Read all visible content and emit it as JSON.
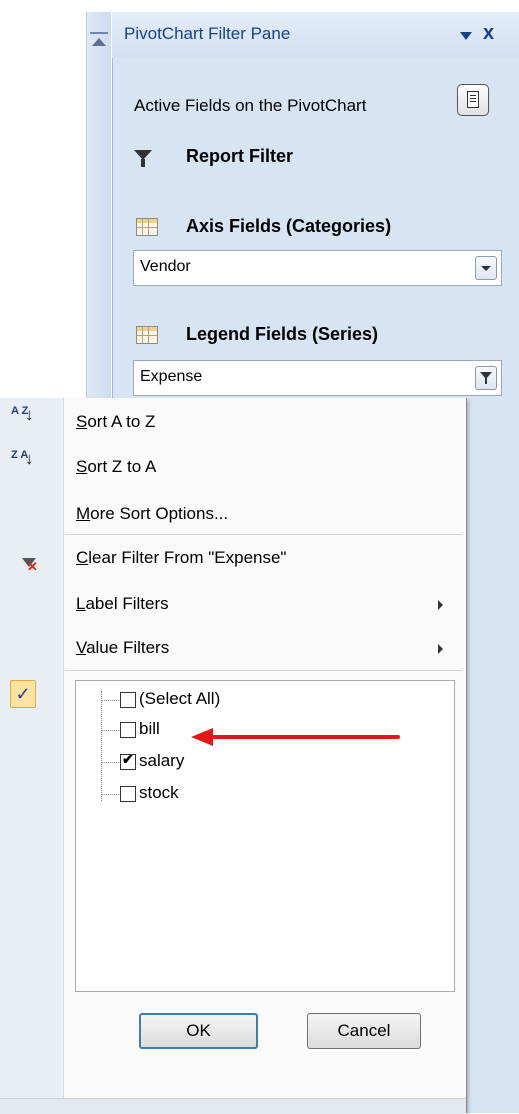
{
  "pane": {
    "title": "PivotChart Filter Pane",
    "close_glyph": "x",
    "active_fields_label": "Active Fields on the PivotChart",
    "report_filter_label": "Report Filter",
    "axis_fields_label": "Axis Fields (Categories)",
    "axis_field_value": "Vendor",
    "legend_fields_label": "Legend Fields (Series)",
    "legend_field_value": "Expense"
  },
  "menu": {
    "sort_az_icon_text": "A Z",
    "sort_za_icon_text": "Z A",
    "sort_az_accel": "S",
    "sort_az_rest": "ort A to Z",
    "sort_za_accel": "S",
    "sort_za_rest": "ort Z to A",
    "more_sort_accel": "M",
    "more_sort_rest": "ore Sort Options...",
    "clear_filter_accel": "C",
    "clear_filter_rest": "lear Filter From \"Expense\"",
    "label_filters_accel": "L",
    "label_filters_rest": "abel Filters",
    "value_filters_accel": "V",
    "value_filters_rest": "alue Filters",
    "check_glyph": "✓"
  },
  "filter_list": {
    "items": [
      {
        "label": "(Select All)",
        "checked": false,
        "check_glyph": ""
      },
      {
        "label": "bill",
        "checked": false,
        "check_glyph": ""
      },
      {
        "label": "salary",
        "checked": true,
        "check_glyph": "✔"
      },
      {
        "label": "stock",
        "checked": false,
        "check_glyph": ""
      }
    ]
  },
  "buttons": {
    "ok": "OK",
    "cancel": "Cancel"
  },
  "colors": {
    "pane_bg": "#d7e4f3",
    "title_text": "#15428b",
    "annotation_arrow": "#e01818"
  },
  "icons": [
    "scroll-up-arrow-icon",
    "layout-icon",
    "funnel-icon",
    "grid-icon",
    "dropdown-arrow-icon",
    "filter-dropdown-icon",
    "sort-az-icon",
    "sort-za-icon",
    "clear-filter-icon",
    "checkmark-icon",
    "submenu-arrow-icon"
  ]
}
